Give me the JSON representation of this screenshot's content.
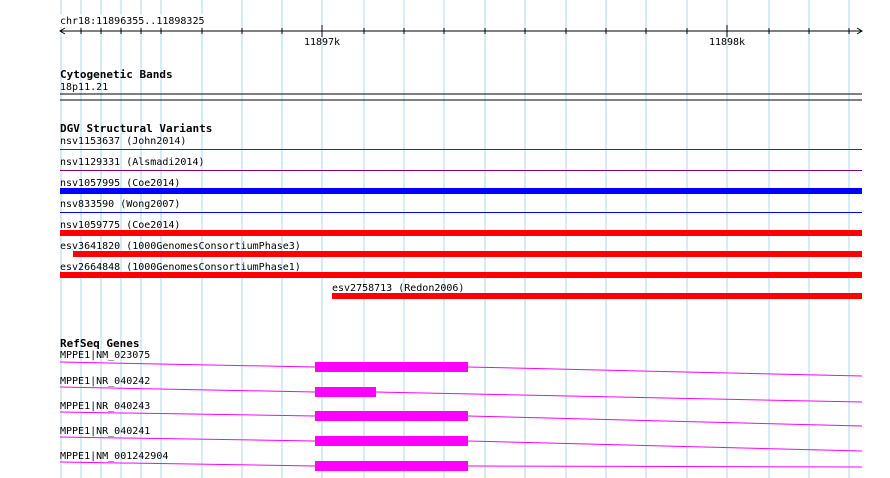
{
  "ruler": {
    "location_label": "chr18:11896355..11898325",
    "ticks": [
      {
        "label": "11897k"
      },
      {
        "label": "11898k"
      }
    ]
  },
  "tracks": {
    "cytoband": {
      "title": "Cytogenetic Bands",
      "band_label": "18p11.21",
      "color": "#000000"
    },
    "dgv": {
      "title": "DGV Structural Variants",
      "items": [
        {
          "label": "nsv1153637 (John2014)",
          "color": "#800080",
          "style": "thin"
        },
        {
          "label": "nsv1129331 (Alsmadi2014)",
          "color": "#800080",
          "style": "thin"
        },
        {
          "label": "nsv1057995 (Coe2014)",
          "color": "#0000ff",
          "style": "thick"
        },
        {
          "label": "nsv833590 (Wong2007)",
          "color": "#0000ff",
          "style": "thin"
        },
        {
          "label": "nsv1059775 (Coe2014)",
          "color": "#ff0000",
          "style": "thick"
        },
        {
          "label": "esv3641820 (1000GenomesConsortiumPhase3)",
          "color": "#ff0000",
          "style": "thick"
        },
        {
          "label": "esv2664848 (1000GenomesConsortiumPhase1)",
          "color": "#ff0000",
          "style": "thick"
        },
        {
          "label": "esv2758713 (Redon2006)",
          "color": "#ff0000",
          "style": "thick"
        }
      ]
    },
    "refseq": {
      "title": "RefSeq Genes",
      "color": "#ff00ff",
      "items": [
        {
          "label": "MPPE1|NM_023075"
        },
        {
          "label": "MPPE1|NR_040242"
        },
        {
          "label": "MPPE1|NR_040243"
        },
        {
          "label": "MPPE1|NR_040241"
        },
        {
          "label": "MPPE1|NM_001242904"
        }
      ]
    }
  },
  "colors": {
    "grid": "#add8e6",
    "ruler": "#000000",
    "text": "#000000"
  }
}
